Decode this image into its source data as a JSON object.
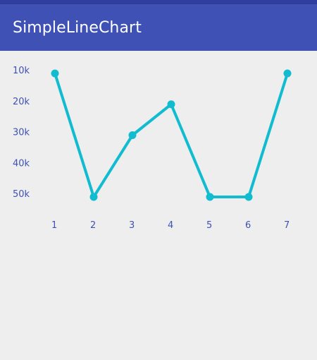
{
  "app": {
    "title": "SimpleLineChart"
  },
  "colors": {
    "status_bar": "#303F9F",
    "app_bar": "#3F51B5",
    "line": "#12BCD0",
    "tick_text": "#3F51B5",
    "background": "#EEEEEE"
  },
  "chart_data": {
    "type": "line",
    "x": [
      1,
      2,
      3,
      4,
      5,
      6,
      7
    ],
    "series": [
      {
        "values": [
          10,
          50,
          30,
          20,
          50,
          50,
          10
        ]
      }
    ],
    "x_ticks": [
      "1",
      "2",
      "3",
      "4",
      "5",
      "6",
      "7"
    ],
    "y_ticks": [
      "10k",
      "20k",
      "30k",
      "40k",
      "50k"
    ],
    "y_tick_values": [
      10,
      20,
      30,
      40,
      50
    ],
    "ylim": [
      10,
      50
    ],
    "y_inverted": true,
    "grid": false
  }
}
